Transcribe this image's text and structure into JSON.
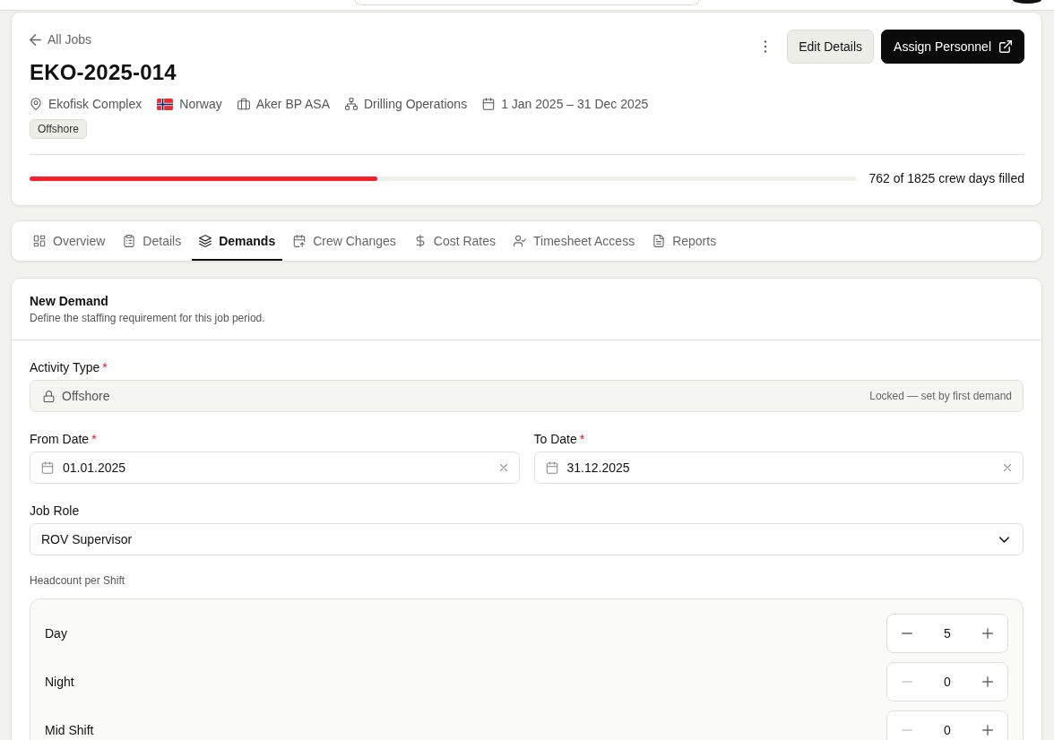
{
  "back_link": "All Jobs",
  "job": {
    "title": "EKO-2025-014",
    "location": "Ekofisk Complex",
    "country": "Norway",
    "client": "Aker BP ASA",
    "department": "Drilling Operations",
    "period": "1 Jan 2025 – 31 Dec 2025",
    "tag": "Offshore"
  },
  "actions": [
    {
      "label": "Edit Details",
      "kind": "secondary"
    },
    {
      "label": "Assign Personnel",
      "kind": "primary"
    }
  ],
  "progress": {
    "level": 0.42,
    "reading": "762 of 1825 crew days filled"
  },
  "tabs": [
    {
      "label": "Overview",
      "selected": false
    },
    {
      "label": "Details",
      "selected": false
    },
    {
      "label": "Demands",
      "selected": true
    },
    {
      "label": "Crew Changes",
      "selected": false
    },
    {
      "label": "Cost Rates",
      "selected": false
    },
    {
      "label": "Timesheet Access",
      "selected": false
    },
    {
      "label": "Reports",
      "selected": false
    }
  ],
  "form": {
    "title": "New Demand",
    "subtitle": "Define the staffing requirement for this job period.",
    "activity_type": {
      "label": "Activity Type",
      "required_mark": "*",
      "value": "Offshore",
      "locked": true,
      "hint": "Locked — set by first demand"
    },
    "dates": [
      {
        "label": "From Date",
        "required_mark": "*",
        "value": "01.01.2025"
      },
      {
        "label": "To Date",
        "required_mark": "*",
        "value": "31.12.2025"
      }
    ],
    "job_role": {
      "label": "Job Role",
      "value": "ROV Supervisor"
    },
    "headcount_label": "Headcount per Shift",
    "shifts": [
      {
        "name": "Day",
        "value": "5",
        "minus_disabled": false
      },
      {
        "name": "Night",
        "value": "0",
        "minus_disabled": true
      },
      {
        "name": "Mid Shift",
        "value": "0",
        "minus_disabled": true
      }
    ]
  }
}
